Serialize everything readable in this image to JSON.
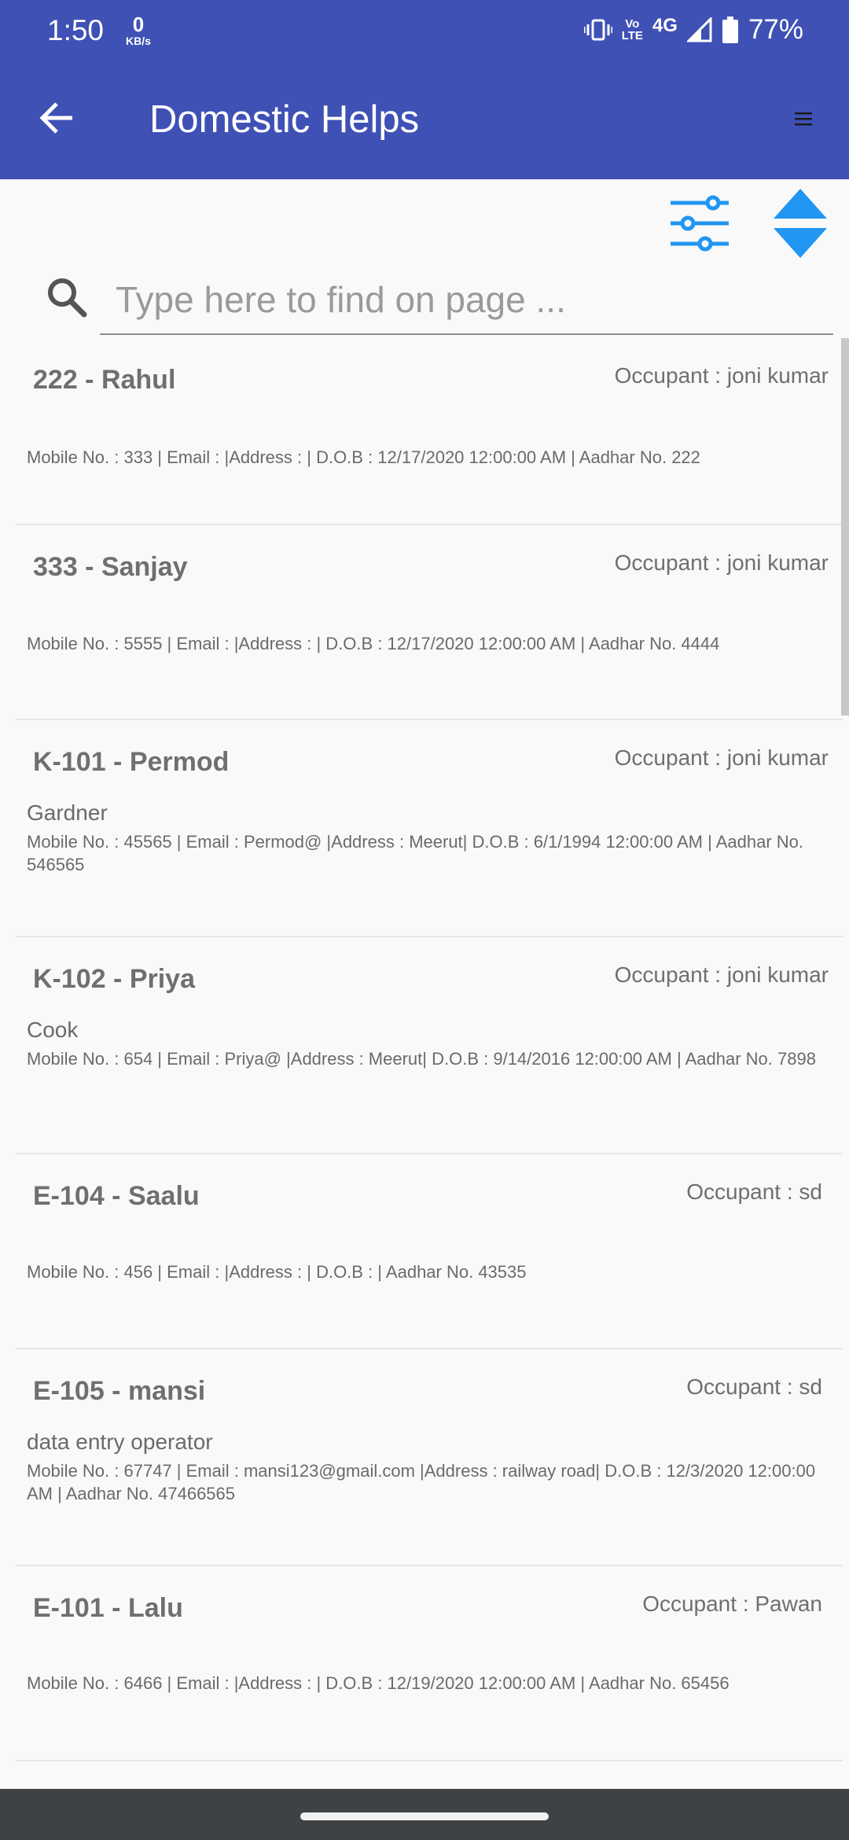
{
  "status_bar": {
    "time": "1:50",
    "net_speed_value": "0",
    "net_speed_unit": "KB/s",
    "lte_top": "Vo",
    "lte_bottom": "LTE",
    "network": "4G",
    "battery": "77%"
  },
  "app_bar": {
    "title": "Domestic Helps",
    "back_icon": "arrow-left-icon",
    "menu_icon": "hamburger-menu-icon"
  },
  "toolbar": {
    "filter_icon": "sliders-filter-icon",
    "sort_icon": "sort-up-down-icon",
    "accent_color": "#2196f3"
  },
  "search": {
    "placeholder": "Type here to find on page ..."
  },
  "items": [
    {
      "title": "222 - Rahul",
      "occupant": "Occupant : joni kumar",
      "role": "",
      "details": "Mobile No. : 333 | Email :  |Address : | D.O.B : 12/17/2020 12:00:00 AM | Aadhar No. 222"
    },
    {
      "title": "333 - Sanjay",
      "occupant": "Occupant : joni kumar",
      "role": "",
      "details": "Mobile No. : 5555 | Email :  |Address : | D.O.B : 12/17/2020 12:00:00 AM | Aadhar No. 4444"
    },
    {
      "title": "K-101 - Permod",
      "occupant": "Occupant : joni kumar",
      "role": "Gardner",
      "details": "Mobile No. : 45565 | Email : Permod@ |Address : Meerut| D.O.B : 6/1/1994 12:00:00 AM | Aadhar No. 546565"
    },
    {
      "title": "K-102 - Priya",
      "occupant": "Occupant : joni kumar",
      "role": "Cook",
      "details": "Mobile No. : 654 | Email : Priya@ |Address : Meerut| D.O.B : 9/14/2016 12:00:00 AM | Aadhar No. 7898"
    },
    {
      "title": "E-104 - Saalu",
      "occupant": "Occupant : sd",
      "role": "",
      "details": "Mobile No. : 456 | Email :  |Address : | D.O.B :  | Aadhar No. 43535"
    },
    {
      "title": "E-105 - mansi",
      "occupant": "Occupant : sd",
      "role": "data entry operator",
      "details": "Mobile No. : 67747 | Email : mansi123@gmail.com |Address : railway road| D.O.B : 12/3/2020 12:00:00 AM | Aadhar No. 47466565"
    },
    {
      "title": "E-101 - Lalu",
      "occupant": "Occupant : Pawan",
      "role": "",
      "details": "Mobile No. : 6466 | Email :  |Address : | D.O.B : 12/19/2020 12:00:00 AM | Aadhar No. 65456"
    }
  ]
}
